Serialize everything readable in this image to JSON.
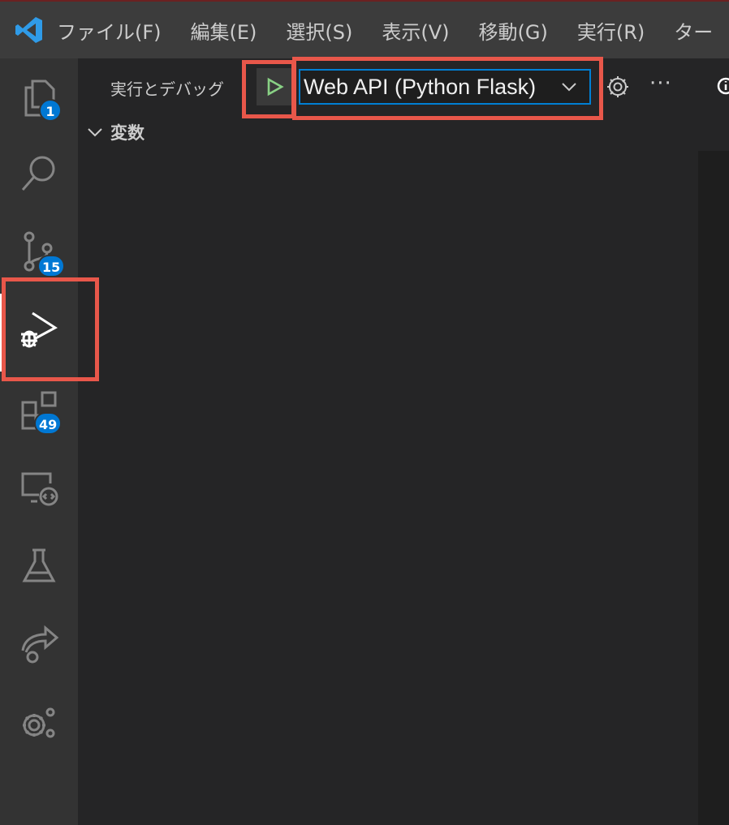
{
  "menubar": {
    "items": [
      "ファイル(F)",
      "編集(E)",
      "選択(S)",
      "表示(V)",
      "移動(G)",
      "実行(R)",
      "ター"
    ]
  },
  "activity_bar": {
    "explorer_badge": "1",
    "source_control_badge": "15",
    "extensions_badge": "49"
  },
  "sidebar": {
    "title": "実行とデバッグ",
    "config_selected": "Web API (Python Flask)",
    "section_variables": "変数"
  },
  "colors": {
    "accent": "#007fd4",
    "badge": "#0078d4",
    "run_green": "#89d185",
    "highlight": "#e8574a"
  },
  "icons": [
    "vscode-logo",
    "files-icon",
    "search-icon",
    "source-control-icon",
    "run-debug-icon",
    "extensions-icon",
    "remote-explorer-icon",
    "testing-icon",
    "live-share-icon",
    "manage-gear-icon",
    "play-icon",
    "chevron-down-icon",
    "gear-icon",
    "ellipsis-icon",
    "info-icon"
  ]
}
